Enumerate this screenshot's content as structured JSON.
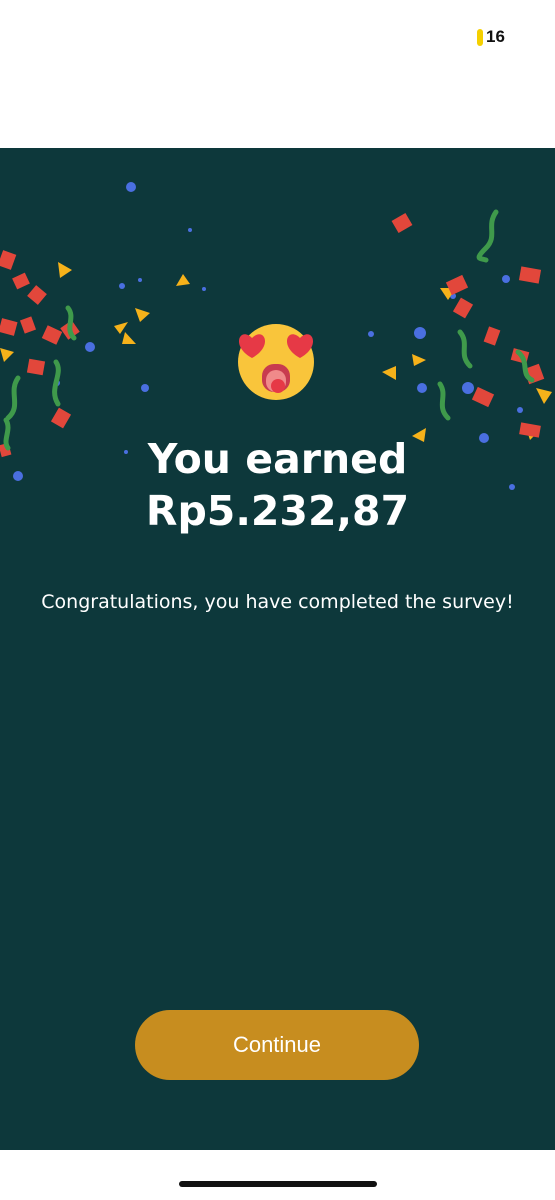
{
  "header": {
    "coin_count": "16",
    "coin_icon": "coin-icon"
  },
  "main": {
    "emoji_icon": "heart-eyes-emoji-icon",
    "title_line1": "You earned",
    "title_line2": "Rp5.232,87",
    "message": "Congratulations, you have completed the survey!",
    "continue_label": "Continue"
  },
  "colors": {
    "background": "#0d383b",
    "button": "#c78d1f",
    "coin": "#f5d000",
    "confetti_red": "#e2473b",
    "confetti_yellow": "#f6b21a",
    "confetti_green": "#3f9a4b",
    "confetti_blue": "#4a6fe0"
  }
}
